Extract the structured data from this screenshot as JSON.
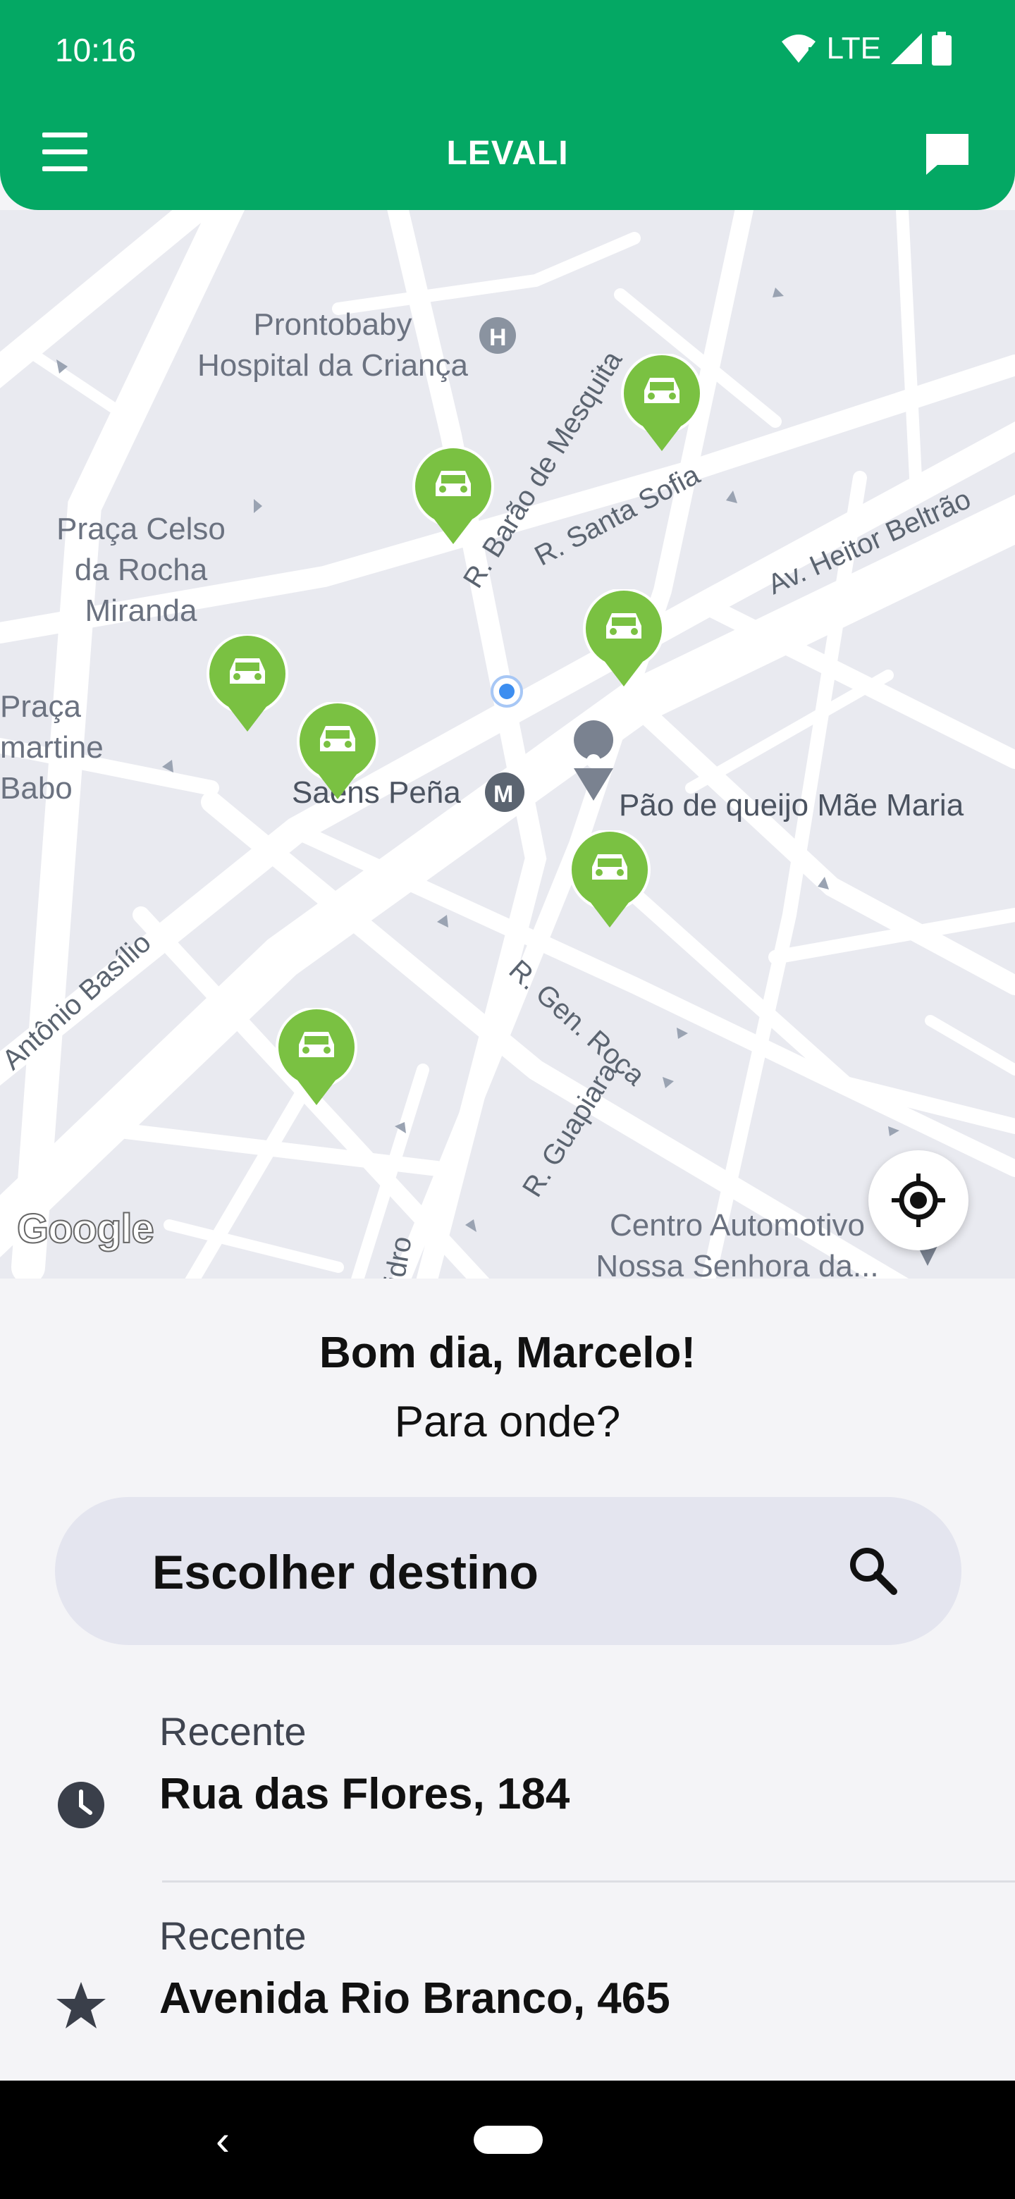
{
  "status_bar": {
    "time": "10:16",
    "network": "LTE"
  },
  "header": {
    "title": "LEVALI"
  },
  "map": {
    "labels": {
      "hospital": "Prontobaby\nHospital da Criança",
      "praca_celso": "Praça Celso\nda Rocha\nMiranda",
      "praca_lamartine": "Praça\nmartine\nBabo",
      "metro": "Saens Peña",
      "pao_de_queijo": "Pão de queijo Mãe Maria",
      "centro_auto": "Centro Automotivo\nNossa Senhora da...",
      "r_barao": "R. Barão de Mesquita",
      "r_santa_sofia": "R. Santa Sofia",
      "av_heitor": "Av. Heitor Beltrão",
      "r_gen_roca": "R. Gen. Roca",
      "r_guapiara": "R. Guapiara",
      "antonio_basilio": "Antônio Basílio",
      "isidro": "idro"
    },
    "attribution": "Google",
    "colors": {
      "car_pin": "#7ac142",
      "user_dot": "#3d8ef0"
    }
  },
  "sheet": {
    "greeting": "Bom dia, Marcelo!",
    "prompt": "Para onde?",
    "search_placeholder": "Escolher destino",
    "recent": [
      {
        "label": "Recente",
        "address": "Rua das Flores, 184",
        "icon": "clock-icon"
      },
      {
        "label": "Recente",
        "address": "Avenida Rio Branco, 465",
        "icon": "star-icon"
      }
    ]
  },
  "colors": {
    "brand": "#04a864"
  }
}
